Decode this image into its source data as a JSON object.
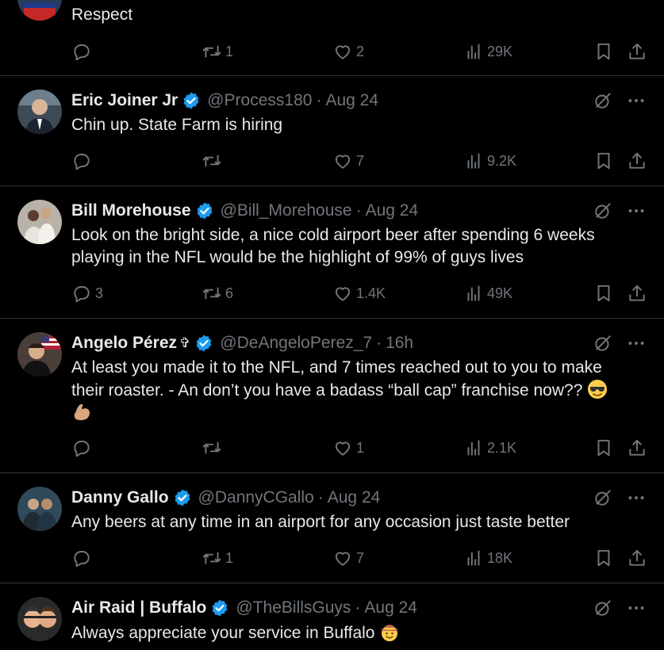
{
  "tweets": [
    {
      "partial": true,
      "text": "Respect",
      "stats": {
        "replies": "",
        "retweets": "1",
        "likes": "2",
        "views": "29K"
      }
    },
    {
      "name": "Eric Joiner Jr",
      "handle": "@Process180",
      "time": "Aug 24",
      "text": "Chin up.  State Farm is hiring",
      "stats": {
        "replies": "",
        "retweets": "",
        "likes": "7",
        "views": "9.2K"
      }
    },
    {
      "name": "Bill Morehouse",
      "handle": "@Bill_Morehouse",
      "time": "Aug 24",
      "text": "Look on the bright side, a nice cold airport beer after spending 6 weeks playing in the NFL would be the highlight of 99% of guys lives",
      "stats": {
        "replies": "3",
        "retweets": "6",
        "likes": "1.4K",
        "views": "49K"
      }
    },
    {
      "name": "Angelo Pérez",
      "name_emoji": "✞",
      "handle": "@DeAngeloPerez_7",
      "time": "16h",
      "text": "At least you made it to the NFL, and 7 times reached out to you to make their roaster.  - An don’t you have a badass “ball cap” franchise now??",
      "stats": {
        "replies": "",
        "retweets": "",
        "likes": "1",
        "views": "2.1K"
      }
    },
    {
      "name": "Danny Gallo",
      "handle": "@DannyCGallo",
      "time": "Aug 24",
      "text": "Any beers at any time in an airport for any occasion just taste better",
      "stats": {
        "replies": "",
        "retweets": "1",
        "likes": "7",
        "views": "18K"
      }
    },
    {
      "name": "Air Raid | Buffalo",
      "handle": "@TheBillsGuys",
      "time": "Aug 24",
      "text": "Always appreciate your service in Buffalo",
      "stats": {
        "replies": "",
        "retweets": "",
        "likes": "",
        "views": ""
      }
    }
  ],
  "separator": "·",
  "colors": {
    "background": "#000000",
    "text": "#e7e9ea",
    "secondary": "#71767b",
    "verified": "#1d9bf0",
    "divider": "#2f3336"
  }
}
